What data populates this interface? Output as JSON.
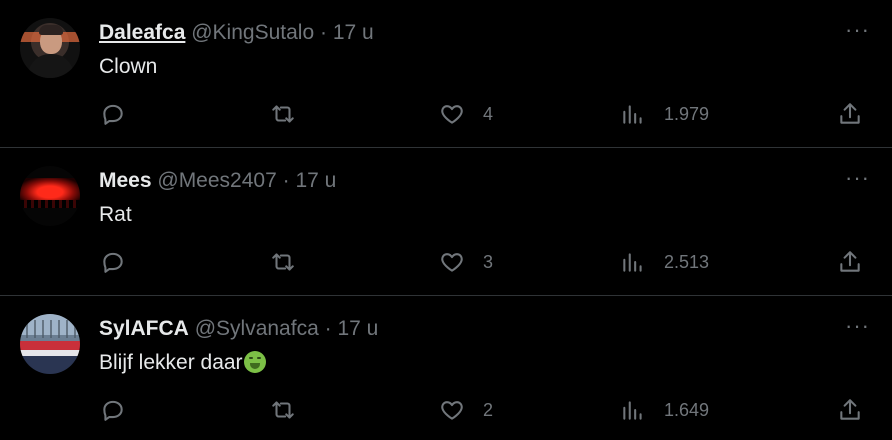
{
  "tweets": [
    {
      "display_name": "Daleafca",
      "handle": "@KingSutalo",
      "separator": "·",
      "time": "17 u",
      "text": "Clown",
      "likes": "4",
      "views": "1.979"
    },
    {
      "display_name": "Mees",
      "handle": "@Mees2407",
      "separator": "·",
      "time": "17 u",
      "text": "Rat",
      "likes": "3",
      "views": "2.513"
    },
    {
      "display_name": "SylAFCA",
      "handle": "@Sylvanafca",
      "separator": "·",
      "time": "17 u",
      "text": "Blijf lekker daar",
      "likes": "2",
      "views": "1.649"
    }
  ],
  "more_glyph": "···",
  "icons": [
    "reply-icon",
    "retweet-icon",
    "heart-icon",
    "views-icon",
    "share-icon",
    "more-icon",
    "nauseated-face-emoji"
  ],
  "colors": {
    "background": "#000000",
    "text": "#e7e9ea",
    "muted": "#71767b",
    "divider": "#2f3336"
  }
}
